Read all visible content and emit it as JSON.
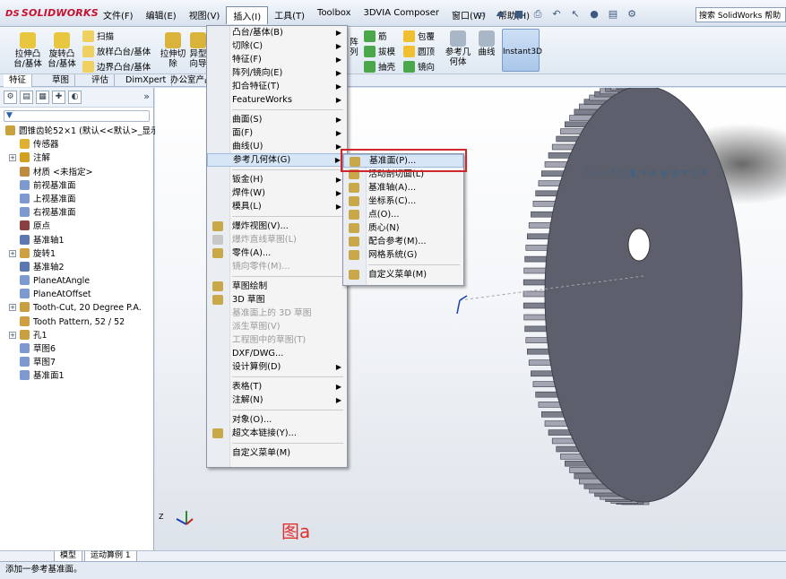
{
  "app": {
    "logo_prefix": "DS",
    "logo": "SOLIDWORKS"
  },
  "menubar": [
    "文件(F)",
    "编辑(E)",
    "视图(V)",
    "插入(I)",
    "工具(T)",
    "Toolbox",
    "3DVIA Composer",
    "窗口(W)",
    "帮助(H)"
  ],
  "search": {
    "placeholder": "搜索 SolidWorks 帮助"
  },
  "ribbon": {
    "extrude_boss": "拉伸凸\n台/基体",
    "revolve_boss": "旋转凸\n台/基体",
    "sweep": "扫描",
    "loft_boss": "放样凸台/基体",
    "boundary_boss": "边界凸台/基体",
    "extrude_cut": "拉伸切\n除",
    "hole_wizard": "异型\n向导",
    "array_label": "阵\n列",
    "rib": "筋",
    "draft": "拔模",
    "shell": "抽壳",
    "wrap": "包覆",
    "dome": "圆顶",
    "mirror": "镜向",
    "ref_geometry": "参考几\n何体",
    "curves": "曲线",
    "instant3d": "Instant3D"
  },
  "tabs": [
    "特征",
    "草图",
    "评估",
    "DimXpert",
    "办公室产品"
  ],
  "tree": {
    "root": "圆锥齿轮52×1  (默认<<默认>_显示",
    "items": [
      {
        "label": "传感器",
        "expand": false
      },
      {
        "label": "注解",
        "expand": true
      },
      {
        "label": "材质 <未指定>",
        "expand": false
      },
      {
        "label": "前视基准面",
        "expand": false
      },
      {
        "label": "上视基准面",
        "expand": false
      },
      {
        "label": "右视基准面",
        "expand": false
      },
      {
        "label": "原点",
        "expand": false
      },
      {
        "label": "基准轴1",
        "expand": false
      },
      {
        "label": "旋转1",
        "expand": true
      },
      {
        "label": "基准轴2",
        "expand": false
      },
      {
        "label": "PlaneAtAngle",
        "expand": false
      },
      {
        "label": "PlaneAtOffset",
        "expand": false
      },
      {
        "label": "Tooth-Cut, 20 Degree P.A.",
        "expand": true
      },
      {
        "label": "Tooth Pattern, 52 / 52",
        "expand": false
      },
      {
        "label": "孔1",
        "expand": true
      },
      {
        "label": "草图6",
        "expand": false
      },
      {
        "label": "草图7",
        "expand": false
      },
      {
        "label": "基准面1",
        "expand": false
      }
    ]
  },
  "insert_menu": [
    {
      "label": "凸台/基体(B)",
      "sub": true
    },
    {
      "label": "切除(C)",
      "sub": true
    },
    {
      "label": "特征(F)",
      "sub": true
    },
    {
      "label": "阵列/镜向(E)",
      "sub": true
    },
    {
      "label": "扣合特征(T)",
      "sub": true
    },
    {
      "label": "FeatureWorks",
      "sub": true
    },
    {
      "sep": true
    },
    {
      "label": "曲面(S)",
      "sub": true
    },
    {
      "label": "面(F)",
      "sub": true
    },
    {
      "label": "曲线(U)",
      "sub": true
    },
    {
      "label": "参考几何体(G)",
      "sub": true,
      "hl": true
    },
    {
      "sep": true
    },
    {
      "label": "钣金(H)",
      "sub": true
    },
    {
      "label": "焊件(W)",
      "sub": true
    },
    {
      "label": "模具(L)",
      "sub": true
    },
    {
      "sep": true
    },
    {
      "label": "爆炸视图(V)...",
      "icon": true
    },
    {
      "label": "爆炸直线草图(L)",
      "dis": true,
      "icon": true
    },
    {
      "label": "零件(A)...",
      "icon": true
    },
    {
      "label": "镜向零件(M)...",
      "dis": true
    },
    {
      "sep": true
    },
    {
      "label": "草图绘制",
      "icon": true
    },
    {
      "label": "3D 草图",
      "icon": true
    },
    {
      "label": "基准面上的 3D 草图",
      "dis": true
    },
    {
      "label": "派生草图(V)",
      "dis": true
    },
    {
      "label": "工程图中的草图(T)",
      "dis": true
    },
    {
      "label": "DXF/DWG..."
    },
    {
      "label": "设计算例(D)",
      "sub": true
    },
    {
      "sep": true
    },
    {
      "label": "表格(T)",
      "sub": true
    },
    {
      "label": "注解(N)",
      "sub": true
    },
    {
      "sep": true
    },
    {
      "label": "对象(O)..."
    },
    {
      "label": "超文本链接(Y)...",
      "icon": true
    },
    {
      "sep": true
    },
    {
      "label": "自定义菜单(M)"
    }
  ],
  "refgeom_menu": [
    {
      "label": "基准面(P)...",
      "hl": true
    },
    {
      "label": "活动剖切面(L)"
    },
    {
      "label": "基准轴(A)..."
    },
    {
      "label": "坐标系(C)..."
    },
    {
      "label": "点(O)..."
    },
    {
      "label": "质心(N)"
    },
    {
      "label": "配合参考(M)..."
    },
    {
      "label": "网格系统(G)"
    },
    {
      "sep": true
    },
    {
      "label": "自定义菜单(M)"
    }
  ],
  "bottom_tabs": [
    "模型",
    "运动算例 1"
  ],
  "status": "添加一参考基准面。",
  "figure_caption": "图a",
  "colors": {
    "highlight_box": "#d0262d",
    "gear": "#5d5f6c",
    "caption": "#e03030"
  }
}
